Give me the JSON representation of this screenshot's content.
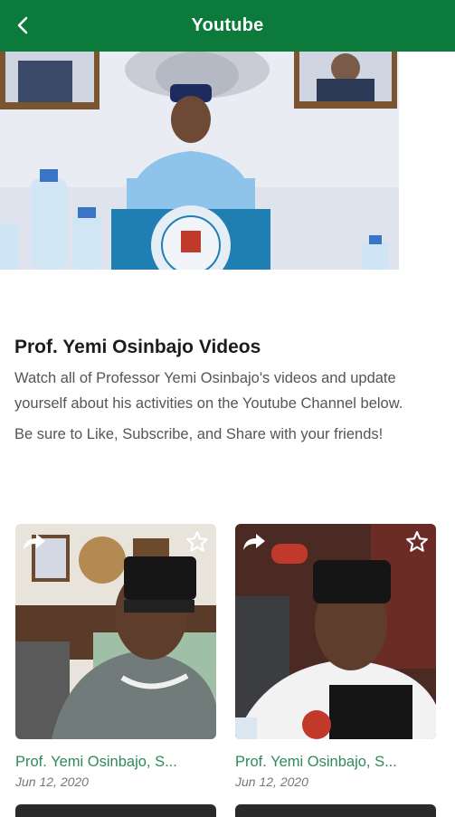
{
  "app_bar": {
    "title": "Youtube",
    "back_icon": "chevron-left-icon",
    "color": "#0c7a3a"
  },
  "section": {
    "title": "Prof. Yemi Osinbajo Videos",
    "description": "Watch all of Professor Yemi Osinbajo's videos and update yourself about his activities on the Youtube Channel below.",
    "call_to_action": "Be sure to Like, Subscribe, and Share with your friends!"
  },
  "videos": [
    {
      "title": "Prof. Yemi Osinbajo, S...",
      "date": "Jun 12, 2020",
      "share_icon": "share-icon",
      "favorite_icon": "star-outline-icon"
    },
    {
      "title": "Prof. Yemi Osinbajo, S...",
      "date": "Jun 12, 2020",
      "share_icon": "share-icon",
      "favorite_icon": "star-outline-icon"
    }
  ]
}
